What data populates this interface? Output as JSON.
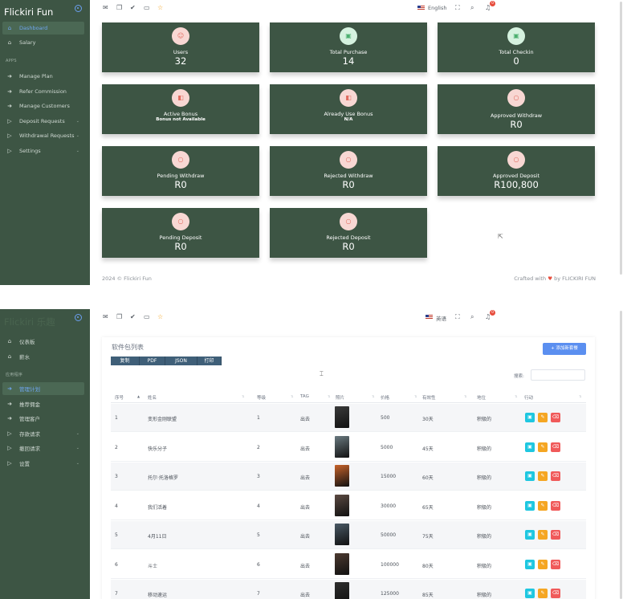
{
  "brand": "Flickiri Fun",
  "colors": {
    "sidebar": "#3d5544",
    "accent": "#6fa6f0",
    "card": "#3d5544",
    "badge": "#e74c3c"
  },
  "screen1": {
    "sidebar": {
      "items_top": [
        {
          "label": "Dashboard",
          "icon": "home-icon",
          "active": true
        },
        {
          "label": "Salary",
          "icon": "home-icon"
        }
      ],
      "section": "APPS",
      "items_apps": [
        {
          "label": "Manage Plan",
          "icon": "arrow-right-icon"
        },
        {
          "label": "Refer Commission",
          "icon": "arrow-right-icon"
        },
        {
          "label": "Manage Customers",
          "icon": "arrow-right-icon"
        },
        {
          "label": "Deposit Requests",
          "icon": "play-icon"
        },
        {
          "label": "Withdrawal Requests",
          "icon": "play-icon"
        },
        {
          "label": "Settings",
          "icon": "play-icon"
        }
      ]
    },
    "topbar": {
      "language": "English",
      "notifications": "0"
    },
    "cards": [
      {
        "label": "Users",
        "value": "32",
        "icon": "user-icon"
      },
      {
        "label": "Total Purchase",
        "value": "14",
        "icon": "briefcase-icon"
      },
      {
        "label": "Total Checkin",
        "value": "0",
        "icon": "briefcase-icon"
      },
      {
        "label": "Active Bonus",
        "sub": "Bonus not Available",
        "icon": "bag-icon"
      },
      {
        "label": "Already Use Bonus",
        "sub": "N/A",
        "icon": "bag-icon"
      },
      {
        "label": "Approved Withdraw",
        "value": "R0",
        "icon": "circle-icon"
      },
      {
        "label": "Pending Withdraw",
        "value": "R0",
        "icon": "circle-icon"
      },
      {
        "label": "Rejected Withdraw",
        "value": "R0",
        "icon": "circle-icon"
      },
      {
        "label": "Approved Deposit",
        "value": "R100,800",
        "icon": "circle-icon"
      },
      {
        "label": "Pending Deposit",
        "value": "R0",
        "icon": "circle-icon"
      },
      {
        "label": "Rejected Deposit",
        "value": "R0",
        "icon": "circle-icon"
      }
    ],
    "footer": {
      "copyright": "2024 © Flickiri Fun",
      "crafted_prefix": "Crafted with",
      "crafted_suffix": "by FLICKIRI FUN"
    }
  },
  "screen2": {
    "brand": "Flickiri 乐趣",
    "sidebar": {
      "items_top": [
        {
          "label": "仪表板",
          "icon": "home-icon"
        },
        {
          "label": "薪水",
          "icon": "home-icon"
        }
      ],
      "section": "应用程序",
      "items_apps": [
        {
          "label": "管理计划",
          "icon": "arrow-right-icon",
          "active": true
        },
        {
          "label": "推荐佣金",
          "icon": "arrow-right-icon"
        },
        {
          "label": "管理客户",
          "icon": "arrow-right-icon"
        },
        {
          "label": "存款请求",
          "icon": "play-icon"
        },
        {
          "label": "撤回请求",
          "icon": "play-icon"
        },
        {
          "label": "设置",
          "icon": "play-icon"
        }
      ]
    },
    "topbar": {
      "language": "英语",
      "notifications": "0"
    },
    "panel_title": "软件包列表",
    "export_buttons": [
      "复制",
      "PDF",
      "JSON",
      "打印"
    ],
    "add_button": "+ 添加新套餐",
    "search_label": "搜索:",
    "columns": [
      "序号",
      "姓名",
      "等级",
      "TAG",
      "照片",
      "价格",
      "有效性",
      "地位",
      "行动"
    ],
    "rows": [
      {
        "no": "1",
        "name": "变形金刚联盟",
        "level": "1",
        "tag": "出去",
        "price": "500",
        "validity": "30天",
        "status": "积极的",
        "poster": "#3a3a3a"
      },
      {
        "no": "2",
        "name": "快乐分子",
        "level": "2",
        "tag": "出去",
        "price": "5000",
        "validity": "45天",
        "status": "积极的",
        "poster": "#6a7a80"
      },
      {
        "no": "3",
        "name": "托尔·托洛格罗",
        "level": "3",
        "tag": "出去",
        "price": "15000",
        "validity": "60天",
        "status": "积极的",
        "poster": "#c7632a"
      },
      {
        "no": "4",
        "name": "我们活着",
        "level": "4",
        "tag": "出去",
        "price": "30000",
        "validity": "65天",
        "status": "积极的",
        "poster": "#5c4a42"
      },
      {
        "no": "5",
        "name": "4月11日",
        "level": "5",
        "tag": "出去",
        "price": "50000",
        "validity": "75天",
        "status": "积极的",
        "poster": "#4a5a66"
      },
      {
        "no": "6",
        "name": "斗士",
        "level": "6",
        "tag": "出去",
        "price": "100000",
        "validity": "80天",
        "status": "积极的",
        "poster": "#4c3a30"
      },
      {
        "no": "7",
        "name": "移动速运",
        "level": "7",
        "tag": "出去",
        "price": "125000",
        "validity": "85天",
        "status": "积极的",
        "poster": "#2e2e2e"
      }
    ]
  }
}
